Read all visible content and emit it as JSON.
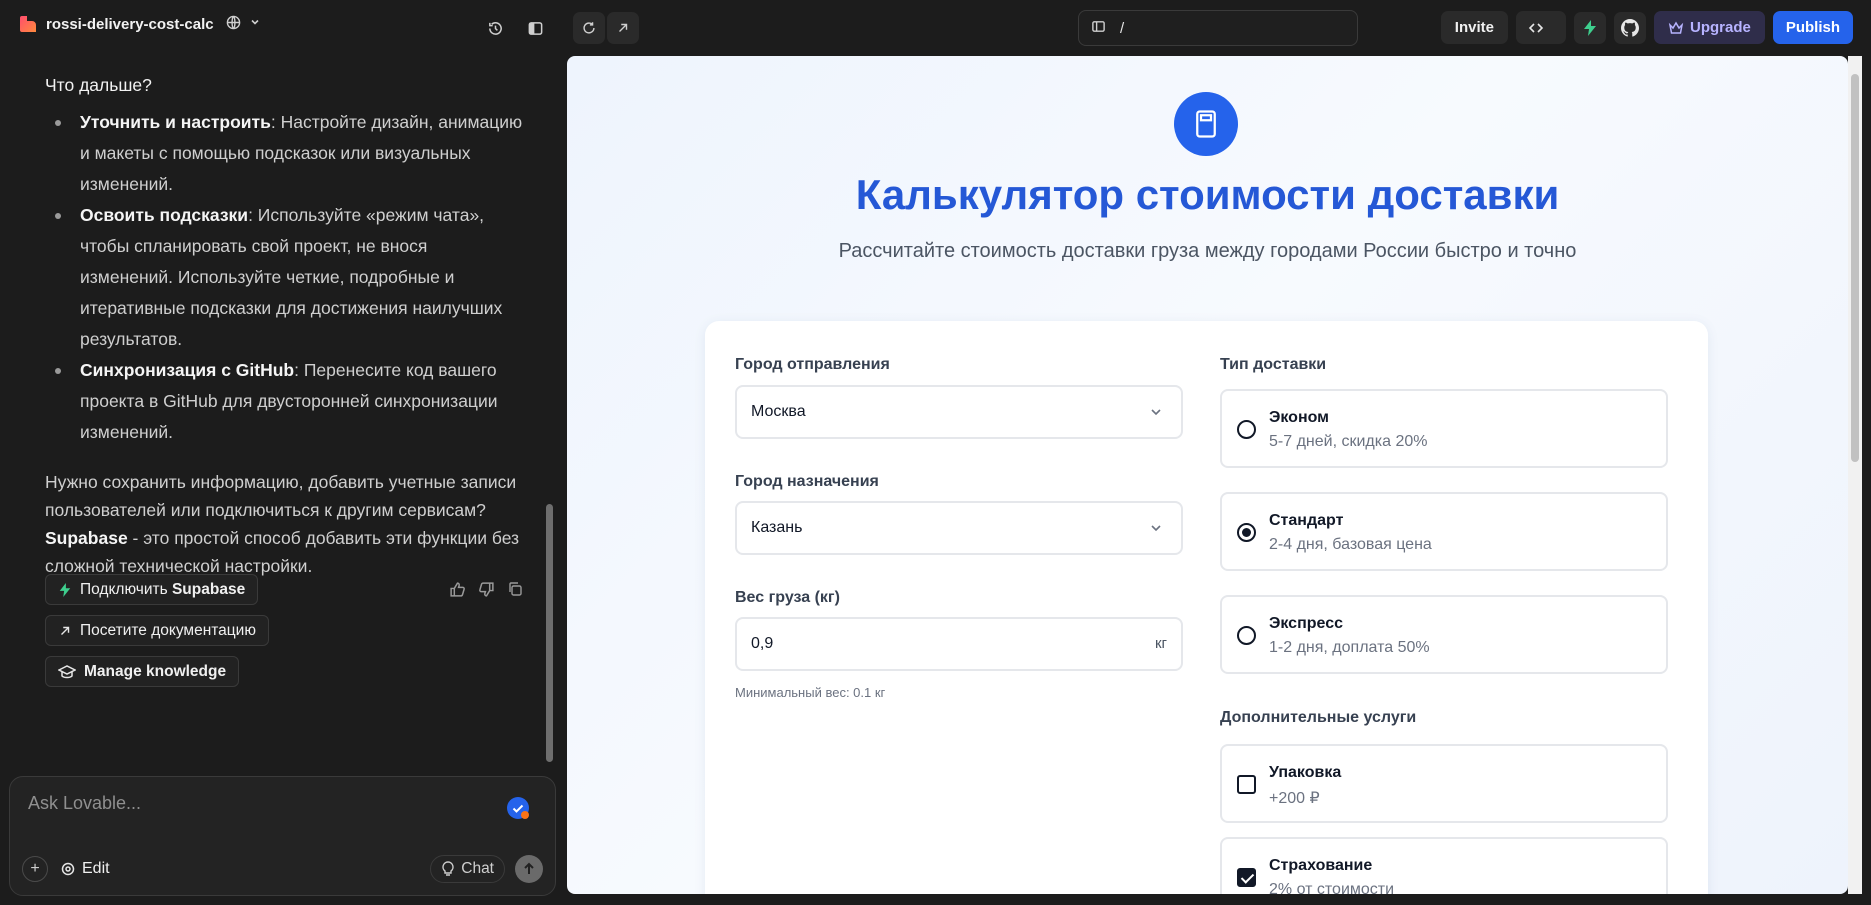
{
  "topbar": {
    "project_name": "rossi-delivery-cost-calc",
    "url_path": "/",
    "invite_label": "Invite",
    "upgrade_label": "Upgrade",
    "publish_label": "Publish",
    "accent": "#2563eb"
  },
  "chat": {
    "heading": "Что дальше?",
    "tips": [
      {
        "title": "Уточнить и настроить",
        "text": ": Настройте дизайн, анимацию и макеты с помощью подсказок или визуальных изменений."
      },
      {
        "title": "Освоить подсказки",
        "text": ": Используйте «режим чата», чтобы спланировать свой проект, не внося изменений. Используйте четкие, подробные и итеративные подсказки для достижения наилучших результатов."
      },
      {
        "title": "Синхронизация с GitHub",
        "text": ": Перенесите код вашего проекта в GitHub для двусторонней синхронизации изменений."
      }
    ],
    "note_text": "Нужно сохранить информацию, добавить учетные записи пользователей или подключиться к другим сервисам? ",
    "note_bold": "Supabase",
    "note_tail": " - это простой способ добавить эти функции без сложной технической настройки.",
    "actions": {
      "connect_prefix": "Подключить ",
      "connect_bold": "Supabase",
      "docs": "Посетите документацию",
      "knowledge": "Manage knowledge"
    },
    "composer": {
      "placeholder": "Ask Lovable...",
      "edit_label": "Edit",
      "chat_label": "Chat"
    }
  },
  "preview": {
    "title": "Калькулятор стоимости доставки",
    "subtitle": "Рассчитайте стоимость доставки груза между городами России быстро и точно",
    "origin": {
      "label": "Город отправления",
      "value": "Москва"
    },
    "destination": {
      "label": "Город назначения",
      "value": "Казань"
    },
    "weight": {
      "label": "Вес груза (кг)",
      "value": "0,9",
      "unit": "кг",
      "hint": "Минимальный вес: 0.1 кг"
    },
    "delivery_type": {
      "label": "Тип доставки",
      "options": [
        {
          "name": "Эконом",
          "desc": "5-7 дней, скидка 20%",
          "selected": false
        },
        {
          "name": "Стандарт",
          "desc": "2-4 дня, базовая цена",
          "selected": true
        },
        {
          "name": "Экспресс",
          "desc": "1-2 дня, доплата 50%",
          "selected": false
        }
      ]
    },
    "extras": {
      "label": "Дополнительные услуги",
      "options": [
        {
          "name": "Упаковка",
          "desc": "+200 ₽",
          "checked": false
        },
        {
          "name": "Страхование",
          "desc": "2% от стоимости",
          "checked": true
        }
      ]
    }
  }
}
